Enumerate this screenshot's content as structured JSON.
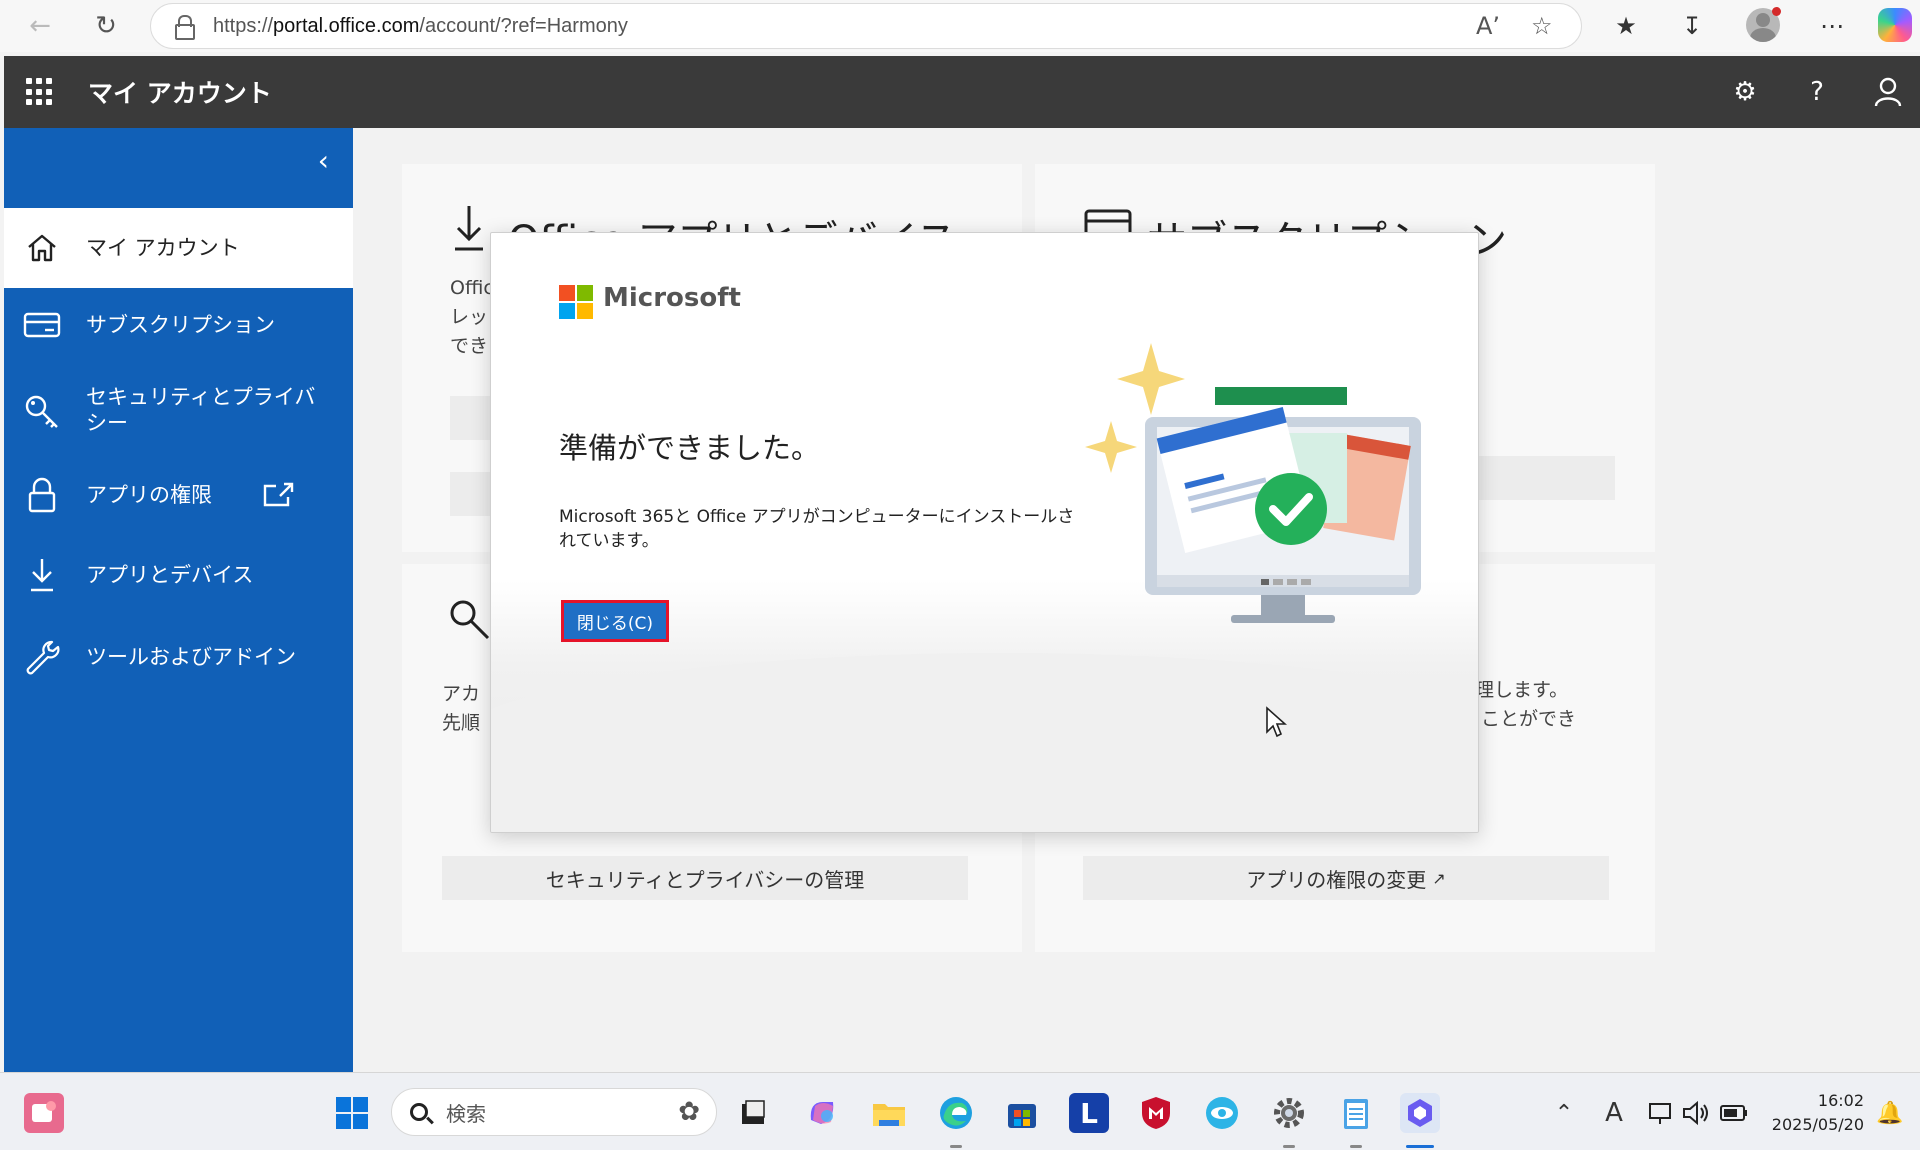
{
  "browser": {
    "url_prefix": "https://",
    "url_domain": "portal.office.com",
    "url_path": "/account/?ref=Harmony"
  },
  "app": {
    "title": "マイ アカウント"
  },
  "sidebar": {
    "items": [
      {
        "label": "マイ アカウント",
        "icon": "home-icon",
        "active": true
      },
      {
        "label": "サブスクリプション",
        "icon": "card-icon"
      },
      {
        "label": "セキュリティとプライバシー",
        "icon": "key-icon"
      },
      {
        "label": "アプリの権限",
        "icon": "lock-icon"
      },
      {
        "label": "アプリとデバイス",
        "icon": "download-icon"
      },
      {
        "label": "ツールおよびアドイン",
        "icon": "wrench-icon"
      }
    ]
  },
  "cards": {
    "office_apps_title": "Office アプリとデバイス",
    "office_frag1": "Offic",
    "office_frag2": "レッ",
    "office_frag3": "でき",
    "subs_title": "サブスクリプション",
    "security_frag1": "アカ",
    "security_frag2": "先順",
    "security_button": "セキュリティとプライバシーの管理",
    "perm_frag1": "理します。",
    "perm_frag2": "ことができ",
    "perm_button": "アプリの権限の変更"
  },
  "dialog": {
    "brand": "Microsoft",
    "title": "準備ができました。",
    "body": "Microsoft 365と Office アプリがコンピューターにインストールされています。",
    "close_button": "閉じる(C)"
  },
  "taskbar": {
    "search_placeholder": "検索",
    "time": "16:02",
    "date": "2025/05/20"
  },
  "colors": {
    "sidebar": "#1160b7",
    "header": "#3a3a3a",
    "button": "#1f6fc5",
    "highlight": "#e5142a"
  }
}
